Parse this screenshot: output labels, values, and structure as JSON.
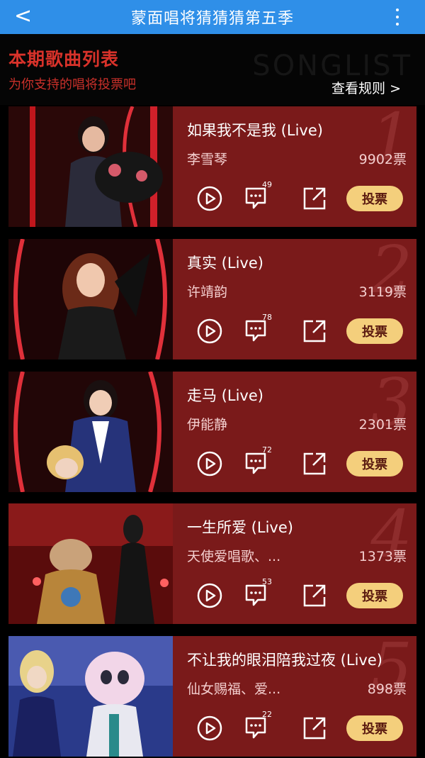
{
  "topbar": {
    "title": "蒙面唱将猜猜猜第五季",
    "back_glyph": "<"
  },
  "header": {
    "title": "本期歌曲列表",
    "subtitle": "为你支持的唱将投票吧",
    "watermark": "SONGLIST",
    "rules_link": "查看规则 >"
  },
  "colors": {
    "topbar": "#2f8fe8",
    "card": "#7a1a1a",
    "accent_red": "#d8322a",
    "vote_button": "#f4cf7c"
  },
  "songs": [
    {
      "rank": "1",
      "title": "如果我不是我 (Live)",
      "singer": "李雪琴",
      "votes": "9902票",
      "comments": "49",
      "vote_label": "投票"
    },
    {
      "rank": "2",
      "title": "真实 (Live)",
      "singer": "许靖韵",
      "votes": "3119票",
      "comments": "78",
      "vote_label": "投票"
    },
    {
      "rank": "3",
      "title": "走马 (Live)",
      "singer": "伊能静",
      "votes": "2301票",
      "comments": "72",
      "vote_label": "投票"
    },
    {
      "rank": "4",
      "title": "一生所爱 (Live)",
      "singer": "天使爱唱歌、...",
      "votes": "1373票",
      "comments": "53",
      "vote_label": "投票"
    },
    {
      "rank": "5",
      "title": "不让我的眼泪陪我过夜 (Live)",
      "singer": "仙女赐福、爱...",
      "votes": "898票",
      "comments": "22",
      "vote_label": "投票"
    }
  ]
}
